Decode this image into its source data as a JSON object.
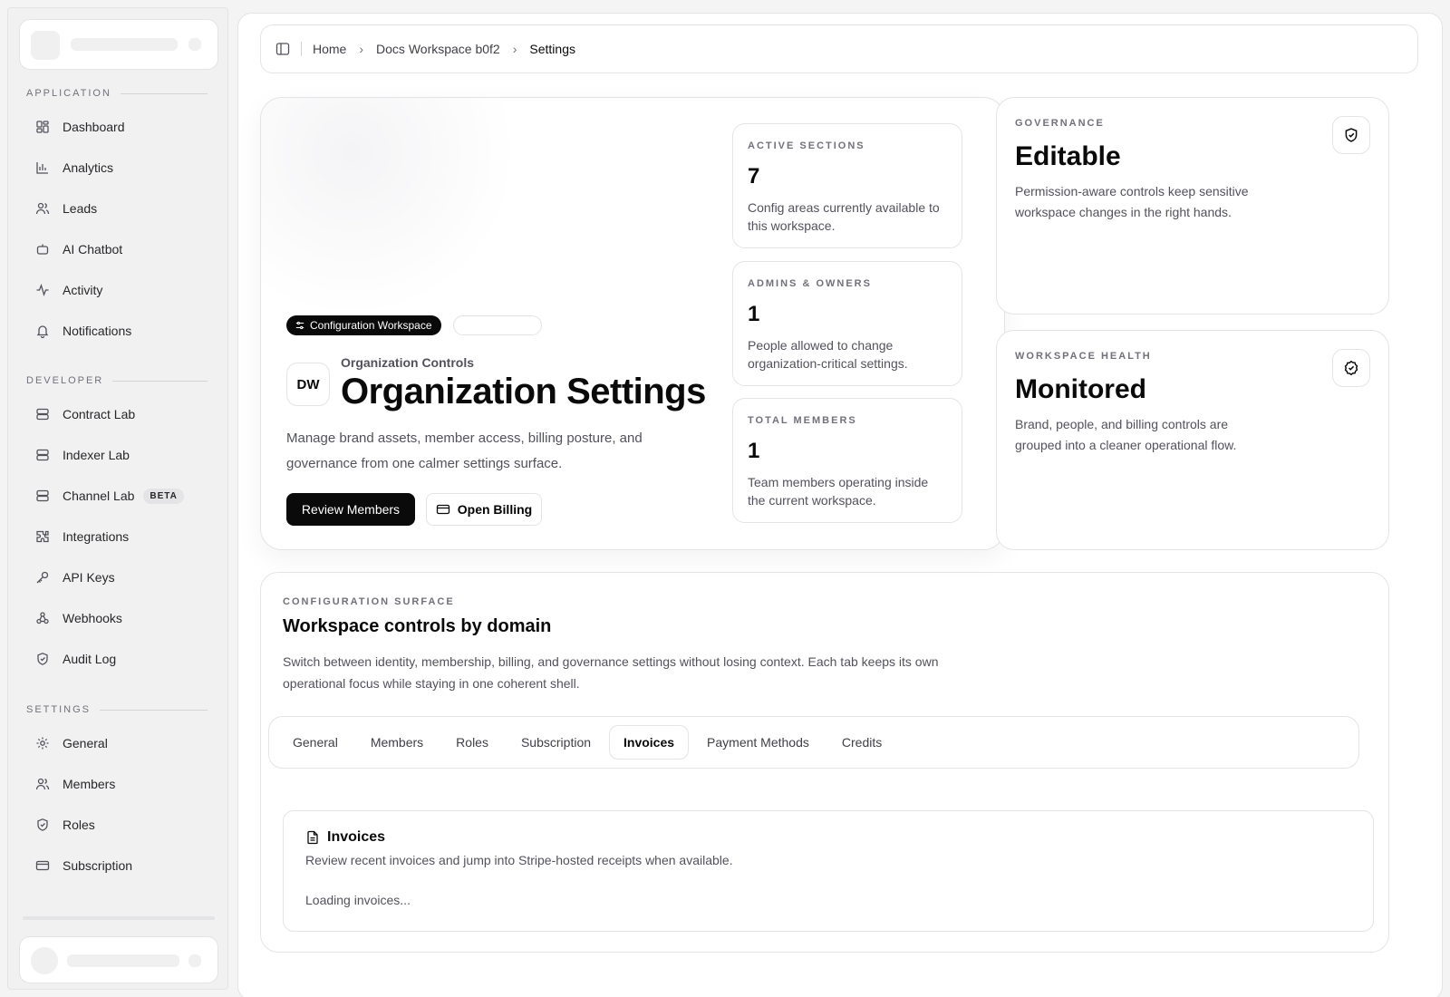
{
  "sidebar": {
    "sections": [
      {
        "label": "APPLICATION",
        "items": [
          {
            "label": "Dashboard",
            "icon": "dashboard-icon"
          },
          {
            "label": "Analytics",
            "icon": "bar-chart-icon"
          },
          {
            "label": "Leads",
            "icon": "users-icon"
          },
          {
            "label": "AI Chatbot",
            "icon": "bot-icon"
          },
          {
            "label": "Activity",
            "icon": "activity-icon"
          },
          {
            "label": "Notifications",
            "icon": "bell-icon"
          }
        ]
      },
      {
        "label": "DEVELOPER",
        "items": [
          {
            "label": "Contract Lab",
            "icon": "server-icon"
          },
          {
            "label": "Indexer Lab",
            "icon": "server-icon"
          },
          {
            "label": "Channel Lab",
            "icon": "server-icon",
            "badge": "BETA"
          },
          {
            "label": "Integrations",
            "icon": "puzzle-icon"
          },
          {
            "label": "API Keys",
            "icon": "key-icon"
          },
          {
            "label": "Webhooks",
            "icon": "webhook-icon"
          },
          {
            "label": "Audit Log",
            "icon": "shield-icon"
          }
        ]
      },
      {
        "label": "SETTINGS",
        "items": [
          {
            "label": "General",
            "icon": "gear-icon"
          },
          {
            "label": "Members",
            "icon": "users-icon"
          },
          {
            "label": "Roles",
            "icon": "shield-icon"
          },
          {
            "label": "Subscription",
            "icon": "credit-card-icon"
          }
        ]
      }
    ]
  },
  "breadcrumb": {
    "home": "Home",
    "workspace": "Docs Workspace b0f2",
    "current": "Settings"
  },
  "hero": {
    "badge": "Configuration Workspace",
    "avatar": "DW",
    "eyebrow": "Organization Controls",
    "title": "Organization Settings",
    "description": "Manage brand assets, member access, billing posture, and governance from one calmer settings surface.",
    "primary_button": "Review Members",
    "secondary_button": "Open Billing"
  },
  "stats": [
    {
      "label": "ACTIVE SECTIONS",
      "value": "7",
      "text": "Config areas currently available to this workspace."
    },
    {
      "label": "ADMINS & OWNERS",
      "value": "1",
      "text": "People allowed to change organization-critical settings."
    },
    {
      "label": "TOTAL MEMBERS",
      "value": "1",
      "text": "Team members operating inside the current workspace."
    }
  ],
  "governance": {
    "label": "GOVERNANCE",
    "value": "Editable",
    "text": "Permission-aware controls keep sensitive workspace changes in the right hands."
  },
  "health": {
    "label": "WORKSPACE HEALTH",
    "value": "Monitored",
    "text": "Brand, people, and billing controls are grouped into a cleaner operational flow."
  },
  "config": {
    "label": "CONFIGURATION SURFACE",
    "title": "Workspace controls by domain",
    "description": "Switch between identity, membership, billing, and governance settings without losing context. Each tab keeps its own operational focus while staying in one coherent shell.",
    "tabs": [
      "General",
      "Members",
      "Roles",
      "Subscription",
      "Invoices",
      "Payment Methods",
      "Credits"
    ],
    "active_tab": "Invoices"
  },
  "invoices": {
    "title": "Invoices",
    "subtitle": "Review recent invoices and jump into Stripe-hosted receipts when available.",
    "status": "Loading invoices..."
  }
}
